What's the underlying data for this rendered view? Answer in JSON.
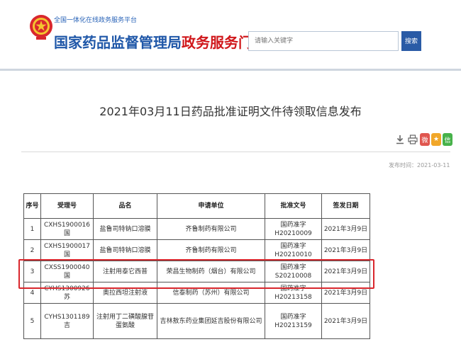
{
  "header": {
    "slogan": "全国一体化在线政务服务平台",
    "title_part1": "国家药品监督管理局",
    "title_part2": "政务服务门户",
    "search_placeholder": "请输入关键字",
    "search_button": "搜索"
  },
  "article": {
    "title": "2021年03月11日药品批准证明文件待领取信息发布",
    "publish_date": "发布时间：2021-03-11"
  },
  "tools": {
    "download_icon": "download-icon",
    "print_icon": "print-icon",
    "share": [
      "weibo",
      "qzone",
      "wechat"
    ]
  },
  "table": {
    "headers": [
      "序号",
      "受理号",
      "品名",
      "申请单位",
      "批准文号",
      "签发日期"
    ],
    "rows": [
      [
        "1",
        "CXHS1900016国",
        "盐鲁司特钠口溶膜",
        "齐鲁制药有限公司",
        "国药准字H20210009",
        "2021年3月9日"
      ],
      [
        "2",
        "CXHS1900017国",
        "盐鲁司特钠口溶膜",
        "齐鲁制药有限公司",
        "国药准字H20210010",
        "2021年3月9日"
      ],
      [
        "3",
        "CXSS1900040国",
        "注射用泰它西普",
        "荣昌生物制药（烟台）有限公司",
        "国药准字S20210008",
        "2021年3月9日"
      ],
      [
        "4",
        "CYHS1300926苏",
        "奥拉西坦注射液",
        "信泰制药（苏州）有限公司",
        "国药准字H20213158",
        "2021年3月9日"
      ],
      [
        "5",
        "CYHS1301189吉",
        "注射用丁二磺酸腺苷蛋氨酸",
        "吉林敖东药业集团延吉股份有限公司",
        "国药准字H20213159",
        "2021年3月9日"
      ]
    ],
    "highlight_color": "#d9272d"
  },
  "colors": {
    "brand_blue": "#1f57a8",
    "brand_red": "#d0171b",
    "search_button": "#2a5ba6"
  }
}
